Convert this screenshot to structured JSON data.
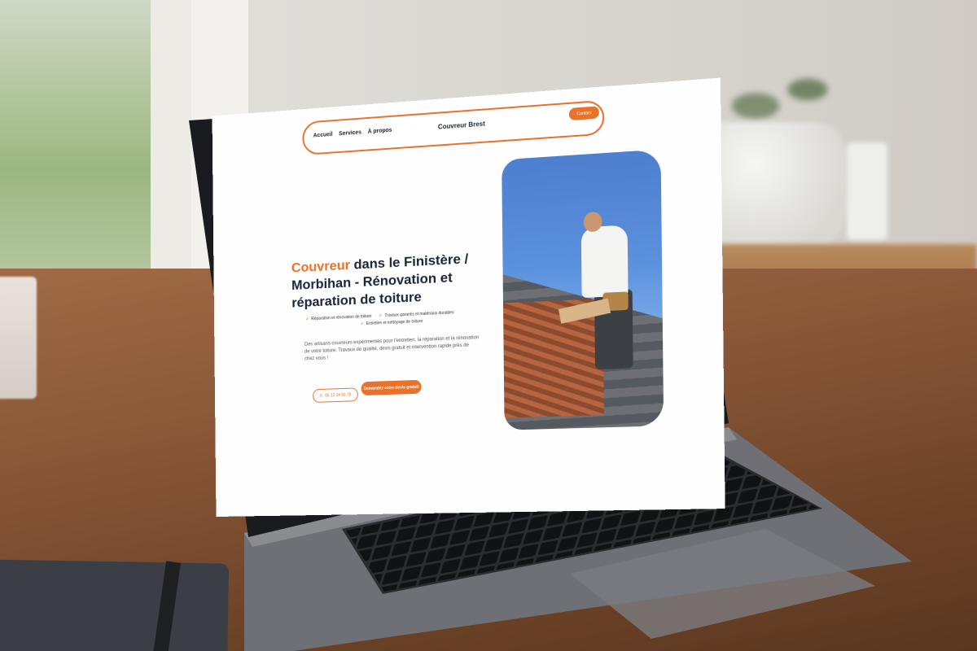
{
  "nav": {
    "links": [
      "Accueil",
      "Services",
      "À propos"
    ],
    "brand": "Couvreur Brest",
    "contact": "Contact"
  },
  "hero": {
    "title_accent": "Couvreur",
    "title_rest": " dans le Finistère / Morbihan - Rénovation et réparation de toiture",
    "checks": [
      "Réparation et rénovation de toiture",
      "Travaux garantis et matériaux durables",
      "Entretien et nettoyage de toiture"
    ],
    "description": "Des artisans couvreurs expérimentés pour l’entretien, la réparation et la rénovation de votre toiture. Travaux de qualité, devis gratuit et intervention rapide près de chez vous !",
    "phone": "06 12 34 56 78",
    "quote_button": "Demandez votre devis gratuit"
  },
  "colors": {
    "accent": "#e8722c",
    "navy": "#1b2433"
  },
  "icons": {
    "phone": "phone-icon",
    "check": "check-icon"
  }
}
